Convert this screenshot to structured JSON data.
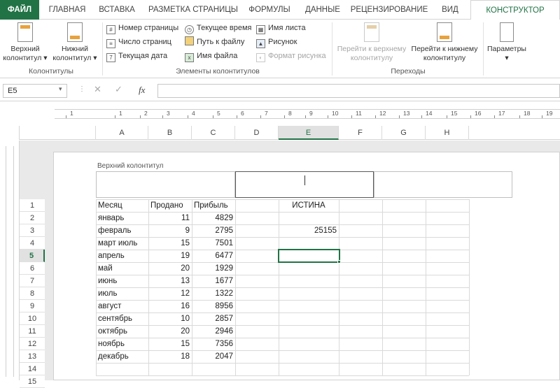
{
  "tabs": [
    "ФАЙЛ",
    "ГЛАВНАЯ",
    "ВСТАВКА",
    "РАЗМЕТКА СТРАНИЦЫ",
    "ФОРМУЛЫ",
    "ДАННЫЕ",
    "РЕЦЕНЗИРОВАНИЕ",
    "ВИД",
    "КОНСТРУКТОР"
  ],
  "ribbon": {
    "header_btn": [
      "Верхний",
      "колонтитул ▾"
    ],
    "footer_btn": [
      "Нижний",
      "колонтитул ▾"
    ],
    "group1_label": "Колонтитулы",
    "elements": [
      "Номер страницы",
      "Число страниц",
      "Текущая дата",
      "Текущее время",
      "Путь к файлу",
      "Имя файла",
      "Имя листа",
      "Рисунок",
      "Формат рисунка"
    ],
    "group2_label": "Элементы колонтитулов",
    "goto_header": [
      "Перейти к верхнему",
      "колонтитулу"
    ],
    "goto_footer": [
      "Перейти к нижнему",
      "колонтитулу"
    ],
    "group3_label": "Переходы",
    "params_btn": "Параметры"
  },
  "formula_bar": {
    "name_box": "E5",
    "fx": "fx",
    "formula": ""
  },
  "ruler_ticks": [
    "1",
    "1",
    "2",
    "3",
    "4",
    "5",
    "6",
    "7",
    "8",
    "9",
    "10",
    "11",
    "12",
    "13",
    "14",
    "15",
    "16",
    "17",
    "18",
    "19"
  ],
  "columns": [
    "A",
    "B",
    "C",
    "D",
    "E",
    "F",
    "G",
    "H"
  ],
  "selected_column": "E",
  "header_label": "Верхний колонтитул",
  "rows": [
    "1",
    "2",
    "3",
    "4",
    "5",
    "6",
    "7",
    "8",
    "9",
    "10",
    "11",
    "12",
    "13",
    "14",
    "15"
  ],
  "selected_row": "5",
  "table": {
    "headers": [
      "Месяц",
      "Продано",
      "Прибыль"
    ],
    "data": [
      [
        "январь",
        "11",
        "4829"
      ],
      [
        "февраль",
        "9",
        "2795"
      ],
      [
        "март   июль",
        "15",
        "7501"
      ],
      [
        "апрель",
        "19",
        "6477"
      ],
      [
        "май",
        "20",
        "1929"
      ],
      [
        "июнь",
        "13",
        "1677"
      ],
      [
        "июль",
        "12",
        "1322"
      ],
      [
        "август",
        "16",
        "8956"
      ],
      [
        "сентябрь",
        "10",
        "2857"
      ],
      [
        "октябрь",
        "20",
        "2946"
      ],
      [
        "ноябрь",
        "15",
        "7356"
      ],
      [
        "декабрь",
        "18",
        "2047"
      ]
    ]
  },
  "e1_value": "ИСТИНА",
  "e3_value": "25155",
  "colors": {
    "accent": "#217346"
  }
}
